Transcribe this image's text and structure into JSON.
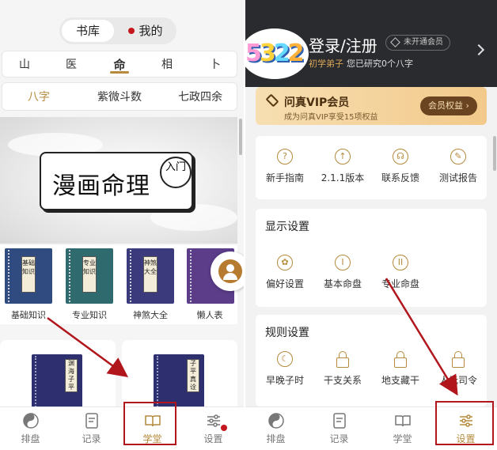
{
  "left": {
    "segment": {
      "library": "书库",
      "mine": "我的"
    },
    "categories": [
      "山",
      "医",
      "命",
      "相",
      "卜"
    ],
    "active_category": "命",
    "subtabs": [
      "八字",
      "紫微斗数",
      "七政四余"
    ],
    "active_subtab": "八字",
    "banner": {
      "title": "漫画命理",
      "badge": "入门"
    },
    "books": [
      {
        "name": "基础知识",
        "cover": "基础知识",
        "color": "#2f4b7f"
      },
      {
        "name": "专业知识",
        "cover": "专业知识",
        "color": "#2f6b6e"
      },
      {
        "name": "神煞大全",
        "cover": "神煞大全",
        "color": "#3a3a7c"
      },
      {
        "name": "懒人表",
        "cover": "",
        "color": "#5b3d8a"
      }
    ],
    "big_books": [
      {
        "cover": "渊海子平"
      },
      {
        "cover": "子平真诠"
      }
    ],
    "bottom_nav": [
      "排盘",
      "记录",
      "学堂",
      "设置"
    ],
    "active_nav": "学堂"
  },
  "right": {
    "logo_text": "5322",
    "login": "登录/注册",
    "member_badge": "未开通会员",
    "level": "初学弟子",
    "research": "您已研究0个八字",
    "vip": {
      "title": "问真VIP会员",
      "subtitle": "成为问真VIP享受15项权益",
      "button": "会员权益 ›"
    },
    "quick": [
      {
        "icon": "?",
        "label": "新手指南"
      },
      {
        "icon": "↑",
        "label": "2.1.1版本"
      },
      {
        "icon": "☊",
        "label": "联系反馈"
      },
      {
        "icon": "✎",
        "label": "测试报告"
      }
    ],
    "display": {
      "title": "显示设置",
      "items": [
        {
          "icon": "✿",
          "label": "偏好设置"
        },
        {
          "icon": "I",
          "label": "基本命盘"
        },
        {
          "icon": "II",
          "label": "专业命盘"
        }
      ]
    },
    "rules": {
      "title": "规则设置",
      "items": [
        {
          "icon": "☾",
          "label": "早晚子时"
        },
        {
          "label": "干支关系"
        },
        {
          "label": "地支藏干"
        },
        {
          "label": "人元司令"
        }
      ]
    },
    "bottom_nav": [
      "排盘",
      "记录",
      "学堂",
      "设置"
    ],
    "active_nav": "设置"
  },
  "colors": {
    "accent": "#b58a3c",
    "highlight": "#b0161c",
    "dark_header": "#2a2b2f"
  }
}
